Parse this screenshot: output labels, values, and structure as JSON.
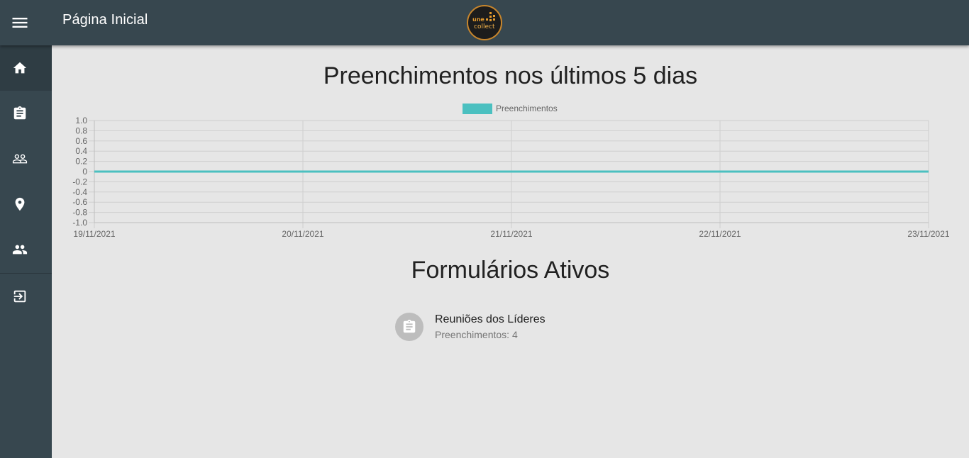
{
  "header": {
    "title": "Página Inicial",
    "logo": {
      "line1": "une",
      "line2": "collect",
      "icon": "unecollect-logo"
    },
    "menu_icon": "menu-icon"
  },
  "sidebar": {
    "items": [
      {
        "icon": "home-icon",
        "active": true
      },
      {
        "icon": "clipboard-icon",
        "active": false
      },
      {
        "icon": "people-outline-icon",
        "active": false
      },
      {
        "icon": "location-pin-icon",
        "active": false
      },
      {
        "icon": "group-icon",
        "active": false
      },
      {
        "icon": "logout-icon",
        "active": false
      }
    ]
  },
  "chart_section": {
    "title": "Preenchimentos nos últimos 5 dias"
  },
  "chart_data": {
    "type": "line",
    "x": [
      "19/11/2021",
      "20/11/2021",
      "21/11/2021",
      "22/11/2021",
      "23/11/2021"
    ],
    "series": [
      {
        "name": "Preenchimentos",
        "values": [
          0,
          0,
          0,
          0,
          0
        ],
        "color": "#4bc0c0"
      }
    ],
    "yticks": [
      "1.0",
      "0.8",
      "0.6",
      "0.4",
      "0.2",
      "0",
      "-0.2",
      "-0.4",
      "-0.6",
      "-0.8",
      "-1.0"
    ],
    "ylim": [
      -1,
      1
    ],
    "grid": true,
    "legend_position": "top-center"
  },
  "forms_section": {
    "title": "Formulários Ativos",
    "items": [
      {
        "name": "Reuniões dos Líderes",
        "count_text": "Preenchimentos: 4",
        "icon": "clipboard-icon"
      }
    ]
  },
  "colors": {
    "appbar": "#37474f",
    "background": "#e6e6e6",
    "series": "#4bc0c0"
  }
}
